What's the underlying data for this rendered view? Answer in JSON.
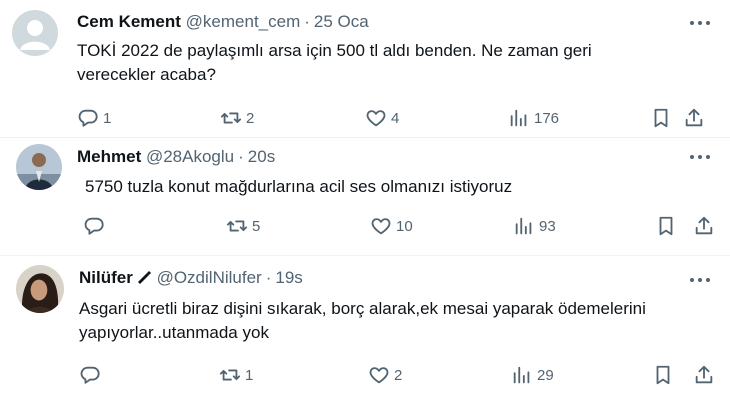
{
  "tweets": [
    {
      "name": "Cem Kement",
      "handle": "@kement_cem",
      "time": "25 Oca",
      "avatar": "default-avatar",
      "text_lines": [
        "TOKİ 2022 de paylaşımlı arsa için 500 tl aldı benden. Ne zaman geri",
        "verecekler acaba?"
      ],
      "replies": "1",
      "reposts": "2",
      "likes": "4",
      "views": "176"
    },
    {
      "name": "Mehmet",
      "handle": "@28Akoglu",
      "time": "20s",
      "avatar": "photo-avatar-man",
      "text_lines": [
        "5750 tuzla konut mağdurlarına acil ses olmanızı istiyoruz"
      ],
      "replies": "",
      "reposts": "5",
      "likes": "10",
      "views": "93"
    },
    {
      "name": "Nilüfer",
      "handle": "@OzdilNilufer",
      "time": "19s",
      "avatar": "photo-avatar-woman",
      "badge": "pen-icon",
      "text_lines": [
        "Asgari ücretli biraz dişini sıkarak, borç alarak,ek mesai yaparak ödemelerini",
        "yapıyorlar..utanmada yok"
      ],
      "replies": "",
      "reposts": "1",
      "likes": "2",
      "views": "29"
    }
  ],
  "separator": "·",
  "colors": {
    "text": "#0f1419",
    "secondary": "#536471",
    "divider": "#eff3f4",
    "default_avatar_bg": "#cfd9de"
  }
}
